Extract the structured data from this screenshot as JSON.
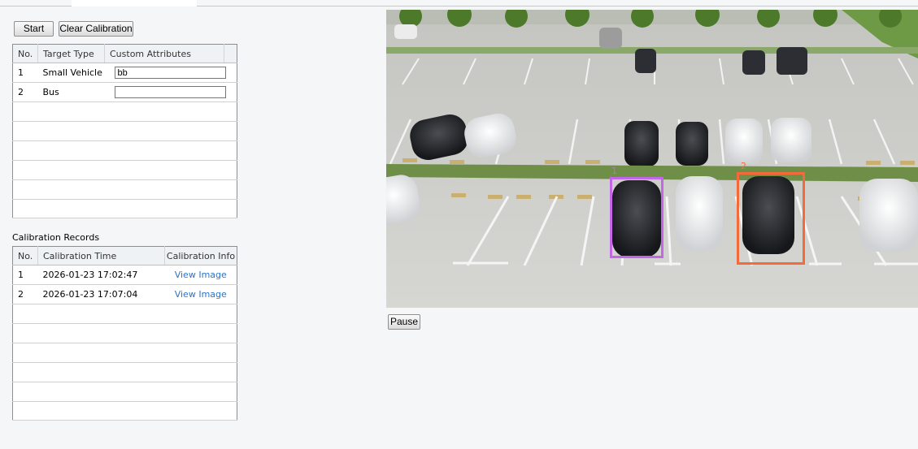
{
  "toolbar": {
    "start_label": "Start",
    "clear_label": "Clear Calibration"
  },
  "targets": {
    "columns": [
      "No.",
      "Target Type",
      "Custom Attributes"
    ],
    "rows": [
      {
        "no": "1",
        "type": "Small Vehicle",
        "attr": "bb"
      },
      {
        "no": "2",
        "type": "Bus",
        "attr": ""
      }
    ]
  },
  "records": {
    "title": "Calibration Records",
    "columns": [
      "No.",
      "Calibration Time",
      "Calibration Info"
    ],
    "rows": [
      {
        "no": "1",
        "time": "2026-01-23 17:02:47",
        "info": "View Image"
      },
      {
        "no": "2",
        "time": "2026-01-23 17:07:04",
        "info": "View Image"
      }
    ]
  },
  "video": {
    "boxes": [
      {
        "label": "1",
        "color": "#c466e8"
      },
      {
        "label": "2",
        "color": "#f46a3a"
      }
    ]
  },
  "player": {
    "pause_label": "Pause"
  }
}
